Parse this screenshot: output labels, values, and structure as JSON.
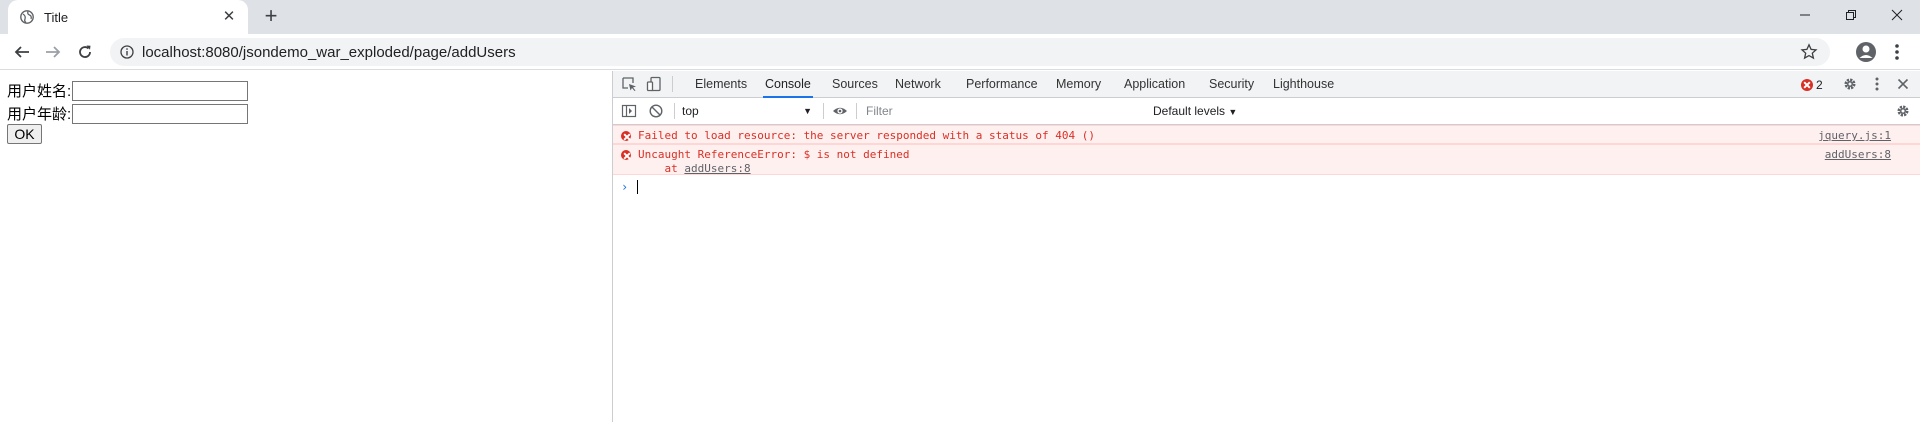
{
  "browser": {
    "tab_title": "Title",
    "new_tab": "+",
    "url": "localhost:8080/jsondemo_war_exploded/page/addUsers"
  },
  "page": {
    "username_label": "用户姓名:",
    "age_label": "用户年龄:",
    "username_value": "",
    "age_value": "",
    "ok_label": "OK"
  },
  "devtools": {
    "tabs": [
      "Elements",
      "Console",
      "Sources",
      "Network",
      "Performance",
      "Memory",
      "Application",
      "Security",
      "Lighthouse"
    ],
    "active_tab": "Console",
    "error_count": "2",
    "context": "top",
    "filter_placeholder": "Filter",
    "levels": "Default levels",
    "messages": [
      {
        "text": "Failed to load resource: the server responded with a status of 404 ()",
        "source": "jquery.js:1"
      },
      {
        "text": "Uncaught ReferenceError: $ is not defined",
        "stack_prefix": "    at ",
        "stack_link": "addUsers:8",
        "source": "addUsers:8"
      }
    ],
    "prompt": "›"
  },
  "colors": {
    "error": "#d93025",
    "error_bg": "#fff0f0",
    "accent": "#1a73e8"
  }
}
